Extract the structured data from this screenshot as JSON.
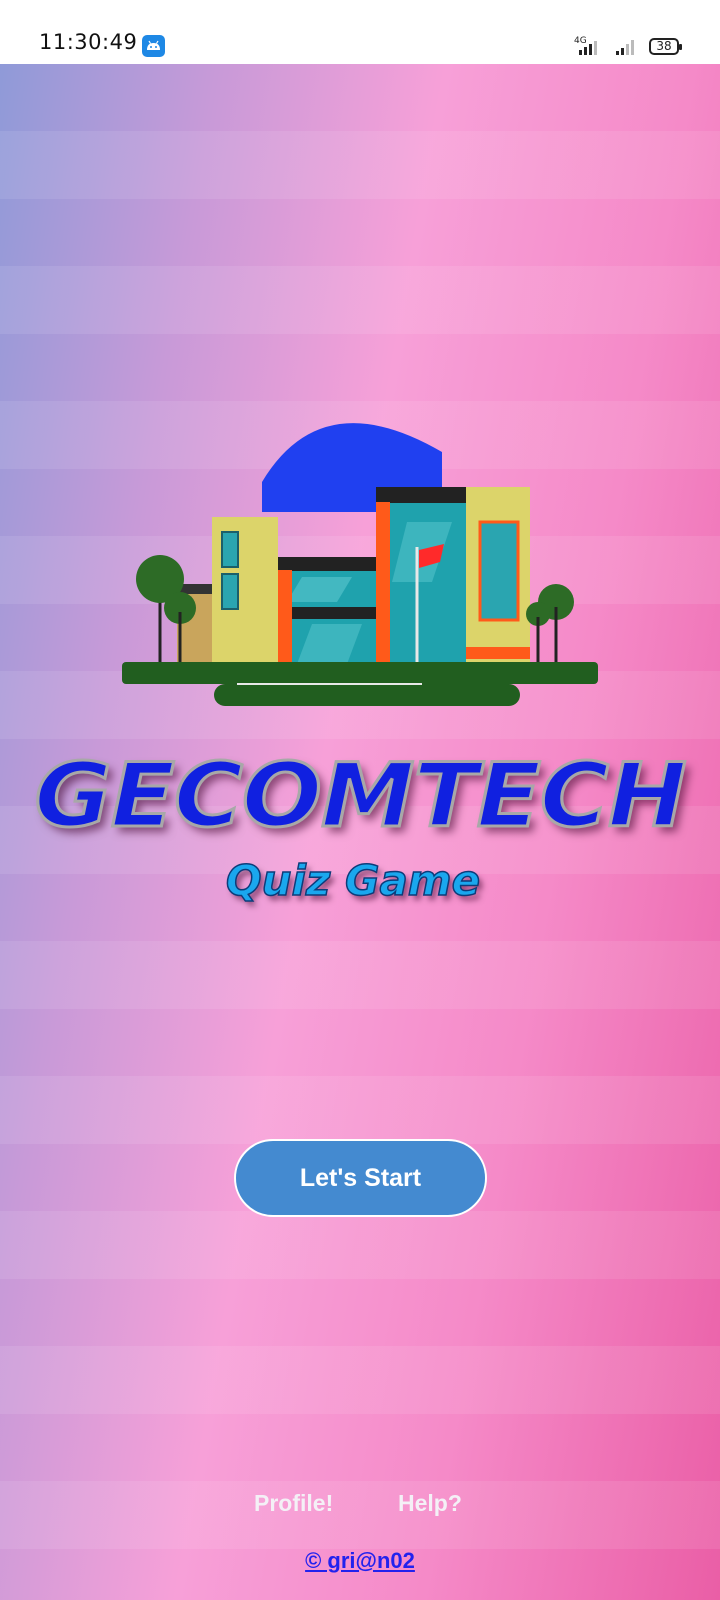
{
  "status_bar": {
    "time": "11:30:49",
    "network": "4G",
    "battery": "38",
    "app_badge_icon": "android-icon"
  },
  "app": {
    "illustration": "building-illustration",
    "title": "GECOMTECH",
    "subtitle": "Quiz Game",
    "start_button": "Let's Start",
    "profile_link": "Profile!",
    "help_link": "Help?",
    "credit": "© gri@n02"
  },
  "colors": {
    "title_fill": "#1020e0",
    "subtitle_fill": "#1aa7ee",
    "button_bg": "#448ad0",
    "credit_link": "#2222ee"
  }
}
